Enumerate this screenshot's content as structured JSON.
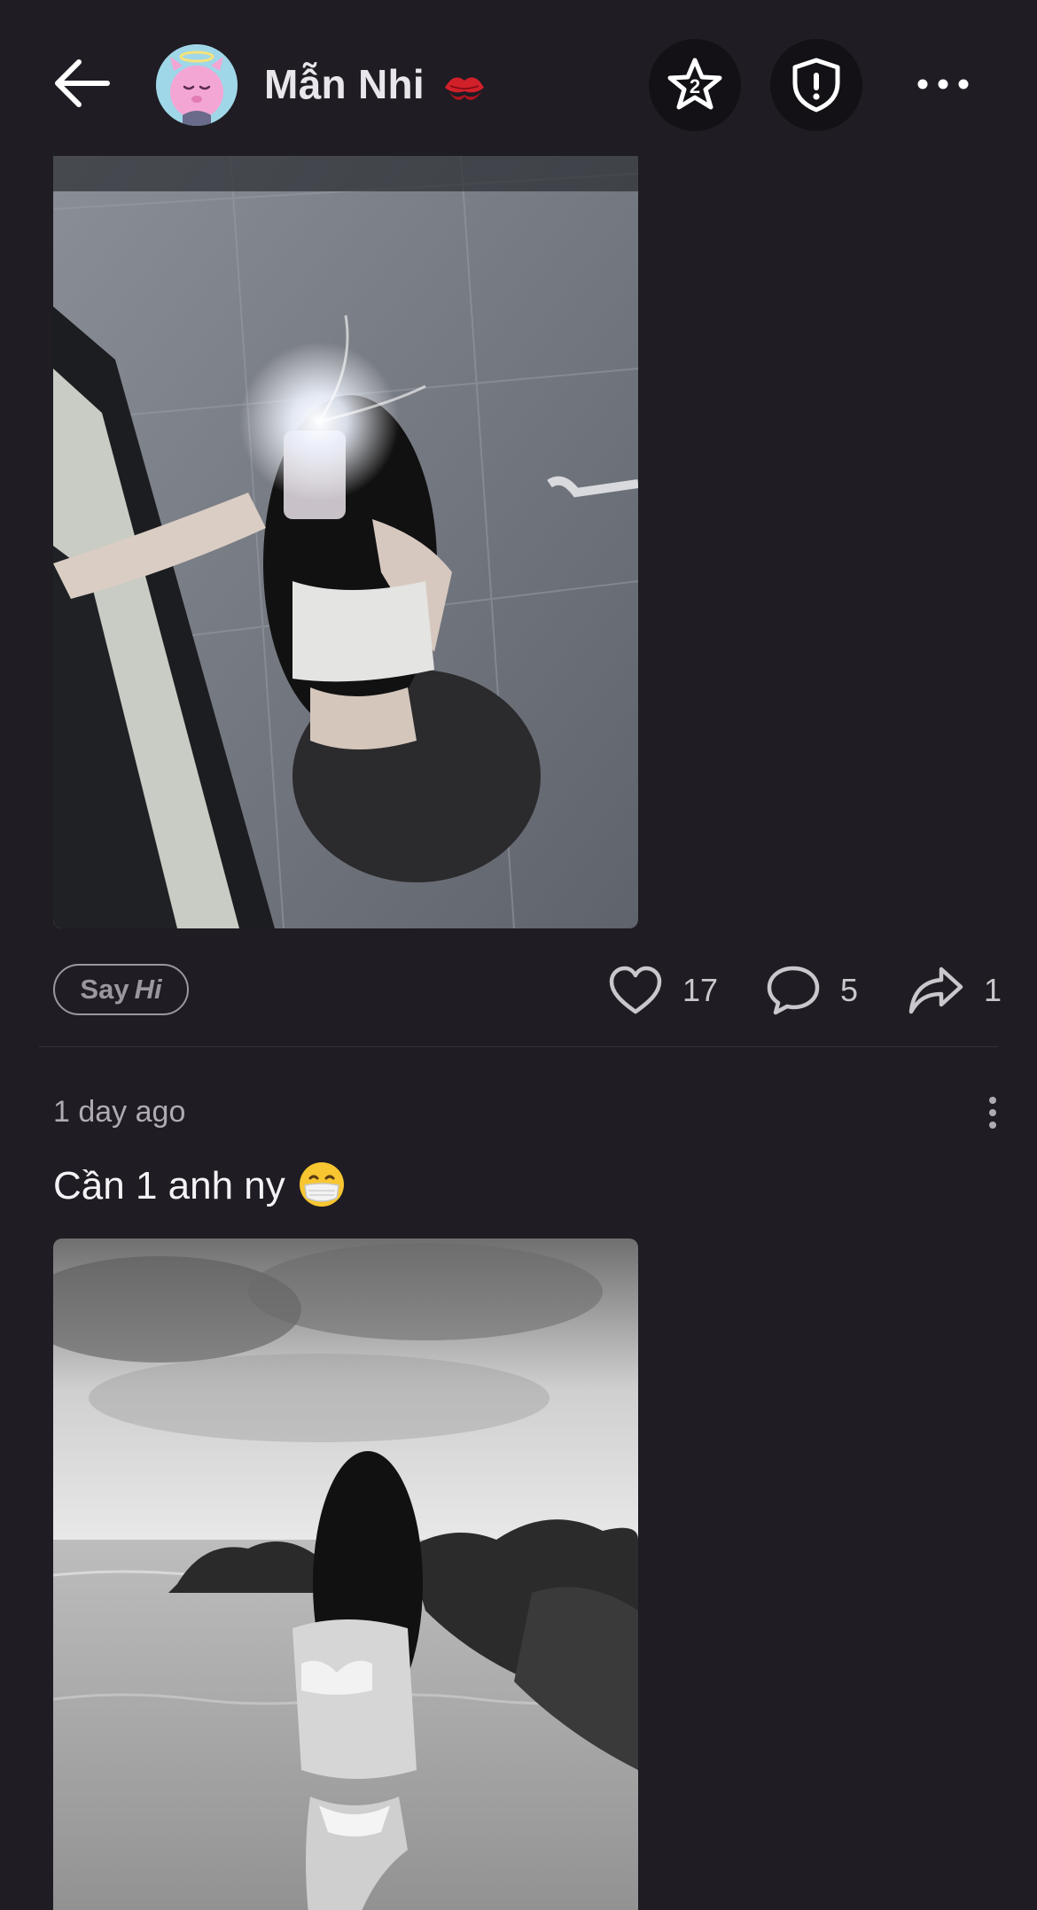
{
  "header": {
    "back_icon": "arrow-left-icon",
    "display_name": "Mẫn Nhi",
    "name_emoji": "kiss-mark-emoji",
    "avatar_icon": "pink-creature-avatar",
    "star_icon": "star-badge-2-icon",
    "star_badge_number": "2",
    "shield_icon": "shield-alert-icon",
    "more_icon": "more-horizontal-icon"
  },
  "posts": [
    {
      "image_desc": "photo",
      "say_hi": {
        "say": "Say",
        "hi": "Hi"
      },
      "likes": "17",
      "comments": "5",
      "shares": "1",
      "like_icon": "heart-icon",
      "comment_icon": "comment-icon",
      "share_icon": "share-icon"
    },
    {
      "timestamp": "1 day ago",
      "caption": "Cần 1 anh ny",
      "caption_emoji": "face-with-medical-mask-emoji",
      "menu_icon": "more-vertical-icon",
      "image_desc": "photo"
    }
  ],
  "colors": {
    "background": "#1f1c23",
    "button_bg": "#131116",
    "muted_text": "#aeabb2",
    "count_text": "#c9c7cc",
    "avatar_bg": "#9fd7e8",
    "avatar_face": "#f3a6d4"
  }
}
